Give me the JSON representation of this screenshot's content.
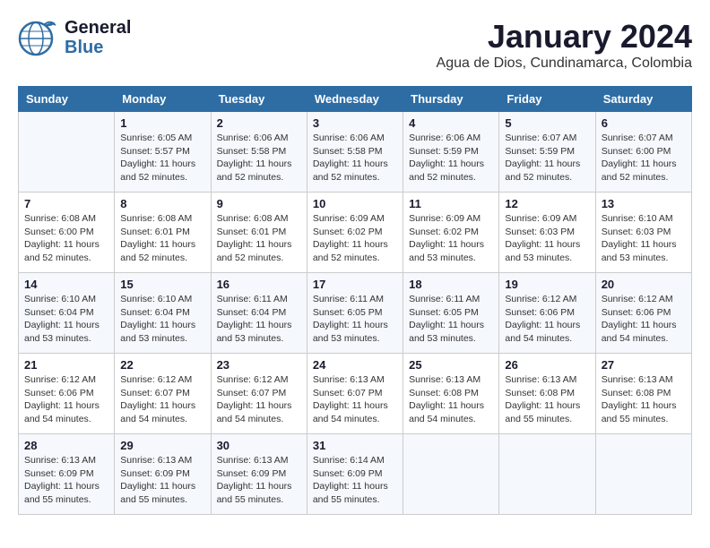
{
  "header": {
    "logo_line1": "General",
    "logo_line2": "Blue",
    "month": "January 2024",
    "location": "Agua de Dios, Cundinamarca, Colombia"
  },
  "weekdays": [
    "Sunday",
    "Monday",
    "Tuesday",
    "Wednesday",
    "Thursday",
    "Friday",
    "Saturday"
  ],
  "weeks": [
    [
      {
        "day": "",
        "info": ""
      },
      {
        "day": "1",
        "info": "Sunrise: 6:05 AM\nSunset: 5:57 PM\nDaylight: 11 hours\nand 52 minutes."
      },
      {
        "day": "2",
        "info": "Sunrise: 6:06 AM\nSunset: 5:58 PM\nDaylight: 11 hours\nand 52 minutes."
      },
      {
        "day": "3",
        "info": "Sunrise: 6:06 AM\nSunset: 5:58 PM\nDaylight: 11 hours\nand 52 minutes."
      },
      {
        "day": "4",
        "info": "Sunrise: 6:06 AM\nSunset: 5:59 PM\nDaylight: 11 hours\nand 52 minutes."
      },
      {
        "day": "5",
        "info": "Sunrise: 6:07 AM\nSunset: 5:59 PM\nDaylight: 11 hours\nand 52 minutes."
      },
      {
        "day": "6",
        "info": "Sunrise: 6:07 AM\nSunset: 6:00 PM\nDaylight: 11 hours\nand 52 minutes."
      }
    ],
    [
      {
        "day": "7",
        "info": "Sunrise: 6:08 AM\nSunset: 6:00 PM\nDaylight: 11 hours\nand 52 minutes."
      },
      {
        "day": "8",
        "info": "Sunrise: 6:08 AM\nSunset: 6:01 PM\nDaylight: 11 hours\nand 52 minutes."
      },
      {
        "day": "9",
        "info": "Sunrise: 6:08 AM\nSunset: 6:01 PM\nDaylight: 11 hours\nand 52 minutes."
      },
      {
        "day": "10",
        "info": "Sunrise: 6:09 AM\nSunset: 6:02 PM\nDaylight: 11 hours\nand 52 minutes."
      },
      {
        "day": "11",
        "info": "Sunrise: 6:09 AM\nSunset: 6:02 PM\nDaylight: 11 hours\nand 53 minutes."
      },
      {
        "day": "12",
        "info": "Sunrise: 6:09 AM\nSunset: 6:03 PM\nDaylight: 11 hours\nand 53 minutes."
      },
      {
        "day": "13",
        "info": "Sunrise: 6:10 AM\nSunset: 6:03 PM\nDaylight: 11 hours\nand 53 minutes."
      }
    ],
    [
      {
        "day": "14",
        "info": "Sunrise: 6:10 AM\nSunset: 6:04 PM\nDaylight: 11 hours\nand 53 minutes."
      },
      {
        "day": "15",
        "info": "Sunrise: 6:10 AM\nSunset: 6:04 PM\nDaylight: 11 hours\nand 53 minutes."
      },
      {
        "day": "16",
        "info": "Sunrise: 6:11 AM\nSunset: 6:04 PM\nDaylight: 11 hours\nand 53 minutes."
      },
      {
        "day": "17",
        "info": "Sunrise: 6:11 AM\nSunset: 6:05 PM\nDaylight: 11 hours\nand 53 minutes."
      },
      {
        "day": "18",
        "info": "Sunrise: 6:11 AM\nSunset: 6:05 PM\nDaylight: 11 hours\nand 53 minutes."
      },
      {
        "day": "19",
        "info": "Sunrise: 6:12 AM\nSunset: 6:06 PM\nDaylight: 11 hours\nand 54 minutes."
      },
      {
        "day": "20",
        "info": "Sunrise: 6:12 AM\nSunset: 6:06 PM\nDaylight: 11 hours\nand 54 minutes."
      }
    ],
    [
      {
        "day": "21",
        "info": "Sunrise: 6:12 AM\nSunset: 6:06 PM\nDaylight: 11 hours\nand 54 minutes."
      },
      {
        "day": "22",
        "info": "Sunrise: 6:12 AM\nSunset: 6:07 PM\nDaylight: 11 hours\nand 54 minutes."
      },
      {
        "day": "23",
        "info": "Sunrise: 6:12 AM\nSunset: 6:07 PM\nDaylight: 11 hours\nand 54 minutes."
      },
      {
        "day": "24",
        "info": "Sunrise: 6:13 AM\nSunset: 6:07 PM\nDaylight: 11 hours\nand 54 minutes."
      },
      {
        "day": "25",
        "info": "Sunrise: 6:13 AM\nSunset: 6:08 PM\nDaylight: 11 hours\nand 54 minutes."
      },
      {
        "day": "26",
        "info": "Sunrise: 6:13 AM\nSunset: 6:08 PM\nDaylight: 11 hours\nand 55 minutes."
      },
      {
        "day": "27",
        "info": "Sunrise: 6:13 AM\nSunset: 6:08 PM\nDaylight: 11 hours\nand 55 minutes."
      }
    ],
    [
      {
        "day": "28",
        "info": "Sunrise: 6:13 AM\nSunset: 6:09 PM\nDaylight: 11 hours\nand 55 minutes."
      },
      {
        "day": "29",
        "info": "Sunrise: 6:13 AM\nSunset: 6:09 PM\nDaylight: 11 hours\nand 55 minutes."
      },
      {
        "day": "30",
        "info": "Sunrise: 6:13 AM\nSunset: 6:09 PM\nDaylight: 11 hours\nand 55 minutes."
      },
      {
        "day": "31",
        "info": "Sunrise: 6:14 AM\nSunset: 6:09 PM\nDaylight: 11 hours\nand 55 minutes."
      },
      {
        "day": "",
        "info": ""
      },
      {
        "day": "",
        "info": ""
      },
      {
        "day": "",
        "info": ""
      }
    ]
  ]
}
